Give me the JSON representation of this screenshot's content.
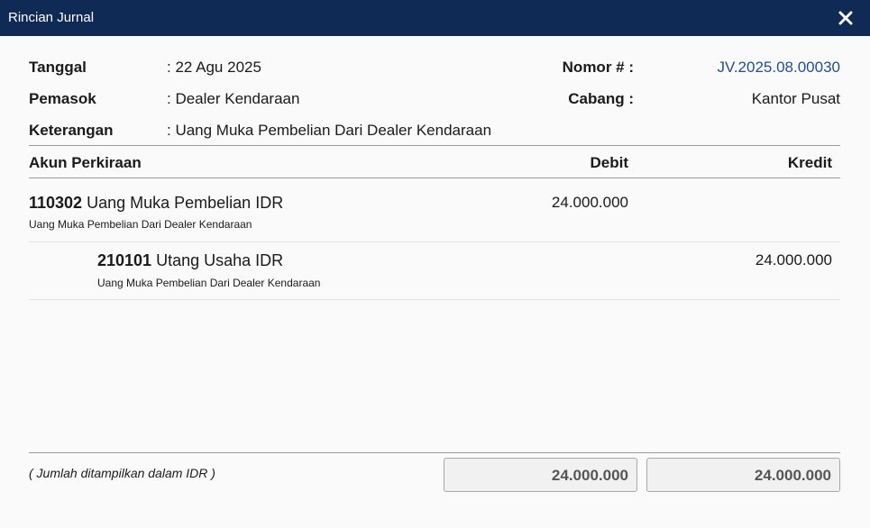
{
  "window": {
    "title": "Rincian Jurnal",
    "close_icon": "close-icon"
  },
  "header": {
    "tanggal_label": "Tanggal",
    "tanggal_value": ": 22 Agu 2025",
    "pemasok_label": "Pemasok",
    "pemasok_value": ": Dealer Kendaraan",
    "keterangan_label": "Keterangan",
    "keterangan_value": ": Uang Muka Pembelian Dari Dealer Kendaraan",
    "nomor_label": "Nomor # :",
    "nomor_value": "JV.2025.08.00030",
    "cabang_label": "Cabang :",
    "cabang_value": "Kantor Pusat"
  },
  "table": {
    "columns": {
      "account": "Akun Perkiraan",
      "debit": "Debit",
      "credit": "Kredit"
    },
    "rows": [
      {
        "code": "110302",
        "name": "Uang Muka Pembelian IDR",
        "memo": "Uang Muka Pembelian Dari Dealer Kendaraan",
        "debit": "24.000.000",
        "credit": ""
      },
      {
        "code": "210101",
        "name": "Utang Usaha IDR",
        "memo": "Uang Muka Pembelian Dari Dealer Kendaraan",
        "debit": "",
        "credit": "24.000.000"
      }
    ]
  },
  "footer": {
    "note": "( Jumlah ditampilkan dalam IDR )",
    "total_debit": "24.000.000",
    "total_credit": "24.000.000"
  },
  "colors": {
    "titlebar": "#0e2a55",
    "link": "#1f4e96"
  }
}
